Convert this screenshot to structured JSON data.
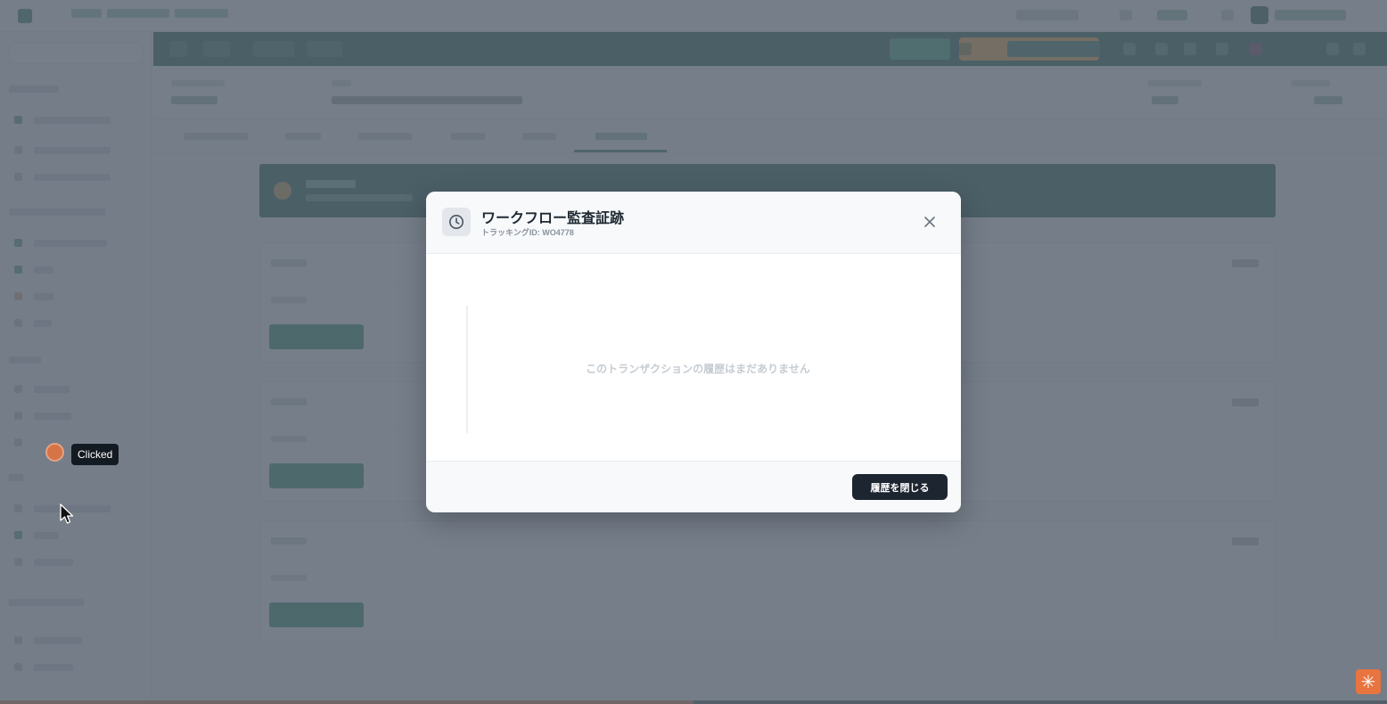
{
  "modal": {
    "title": "ワークフロー監査証跡",
    "subtitle": "トラッキングID: WO4778",
    "empty_message": "このトランザクションの履歴はまだありません",
    "close_history_button": "履歴を閉じる",
    "header_icon": "clock-icon",
    "close_icon": "close-icon"
  },
  "click_indicator": {
    "label": "Clicked"
  },
  "corner_widget": {
    "icon": "asterisk-icon"
  },
  "colors": {
    "header_band": "#14563f",
    "accent_green": "#1f8a5c",
    "accent_orange": "#f0a82c",
    "modal_button": "#1c2530",
    "progress": "#e0793f",
    "click_marker": "#e0743f"
  }
}
